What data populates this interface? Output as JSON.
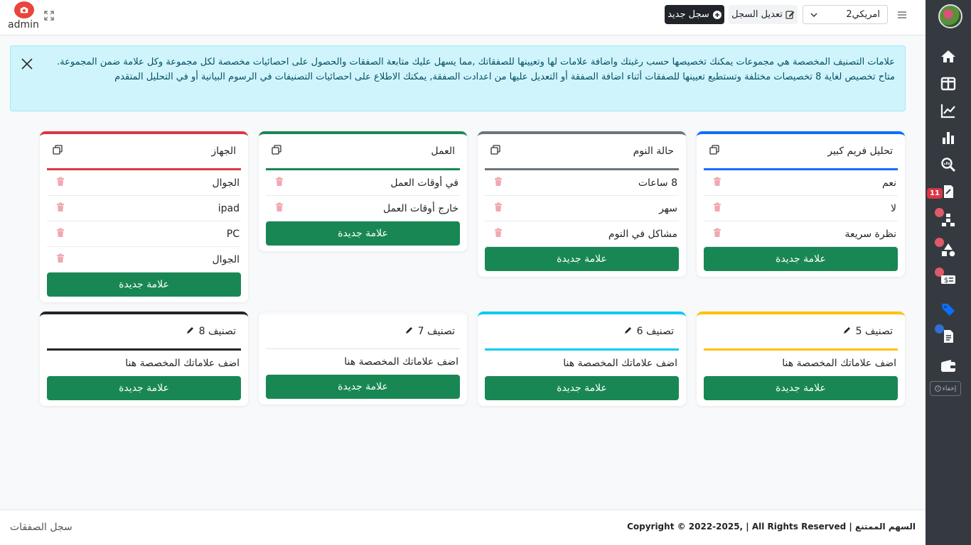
{
  "header": {
    "logo_text": "admin",
    "account_select": "امريكي2",
    "edit_button": "تعديل السجل",
    "new_button": "سجل جديد"
  },
  "alert": {
    "line1": "علامات التصنيف المخصصة هي مجموعات يمكنك تخصيصها حسب رغبتك واضافة علامات لها وتعيينها للصفقاتك ,مما يسهل عليك متابعة الصفقات والحصول على احصائيات مخصصة لكل مجموعة وكل علامة ضمن المجموعة.",
    "line2": "متاح تخصيص لغاية 8 تخصيصات مختلفة وتستطيع تعيينها للصفقات أثناء اضافة الصفقة أو التعديل عليها من اعدادت الصفقة, يمكنك الاطلاع على احصائيات التصنيفات في الرسوم البيانية أو في التحليل المتقدم"
  },
  "sidebar": {
    "badge": "11",
    "hide_label": "إخفاء"
  },
  "cards": [
    {
      "title": "تحليل فريم كبير",
      "color": "#0d6efd",
      "tags": [
        "نعم",
        "لا",
        "نظرة سريعة"
      ],
      "add_label": "علامة جديدة"
    },
    {
      "title": "حالة النوم",
      "color": "#6c757d",
      "tags": [
        "8 ساعات",
        "سهر",
        "مشاكل في النوم"
      ],
      "add_label": "علامة جديدة"
    },
    {
      "title": "العمل",
      "color": "#198754",
      "tags": [
        "في أوقات العمل",
        "خارج أوقات العمل"
      ],
      "add_label": "علامة جديدة"
    },
    {
      "title": "الجهاز",
      "color": "#dc3545",
      "tags": [
        "الجوال",
        "ipad",
        "PC",
        "الجوال"
      ],
      "add_label": "علامة جديدة"
    },
    {
      "title": "تصنيف 5",
      "color": "#ffc107",
      "placeholder": "اضف علاماتك المخصصة هنا",
      "add_label": "علامة جديدة"
    },
    {
      "title": "تصنيف 6",
      "color": "#0dcaf0",
      "placeholder": "اضف علاماتك المخصصة هنا",
      "add_label": "علامة جديدة"
    },
    {
      "title": "تصنيف 7",
      "color": "#f8f9fa",
      "placeholder": "اضف علاماتك المخصصة هنا",
      "add_label": "علامة جديدة"
    },
    {
      "title": "تصنيف 8",
      "color": "#212529",
      "placeholder": "اضف علاماتك المخصصة هنا",
      "add_label": "علامة جديدة"
    }
  ],
  "footer": {
    "left": "سجل الصفقات",
    "right": "السهم الممتنع | Copyright © 2022-2025, | All Rights Reserved"
  }
}
